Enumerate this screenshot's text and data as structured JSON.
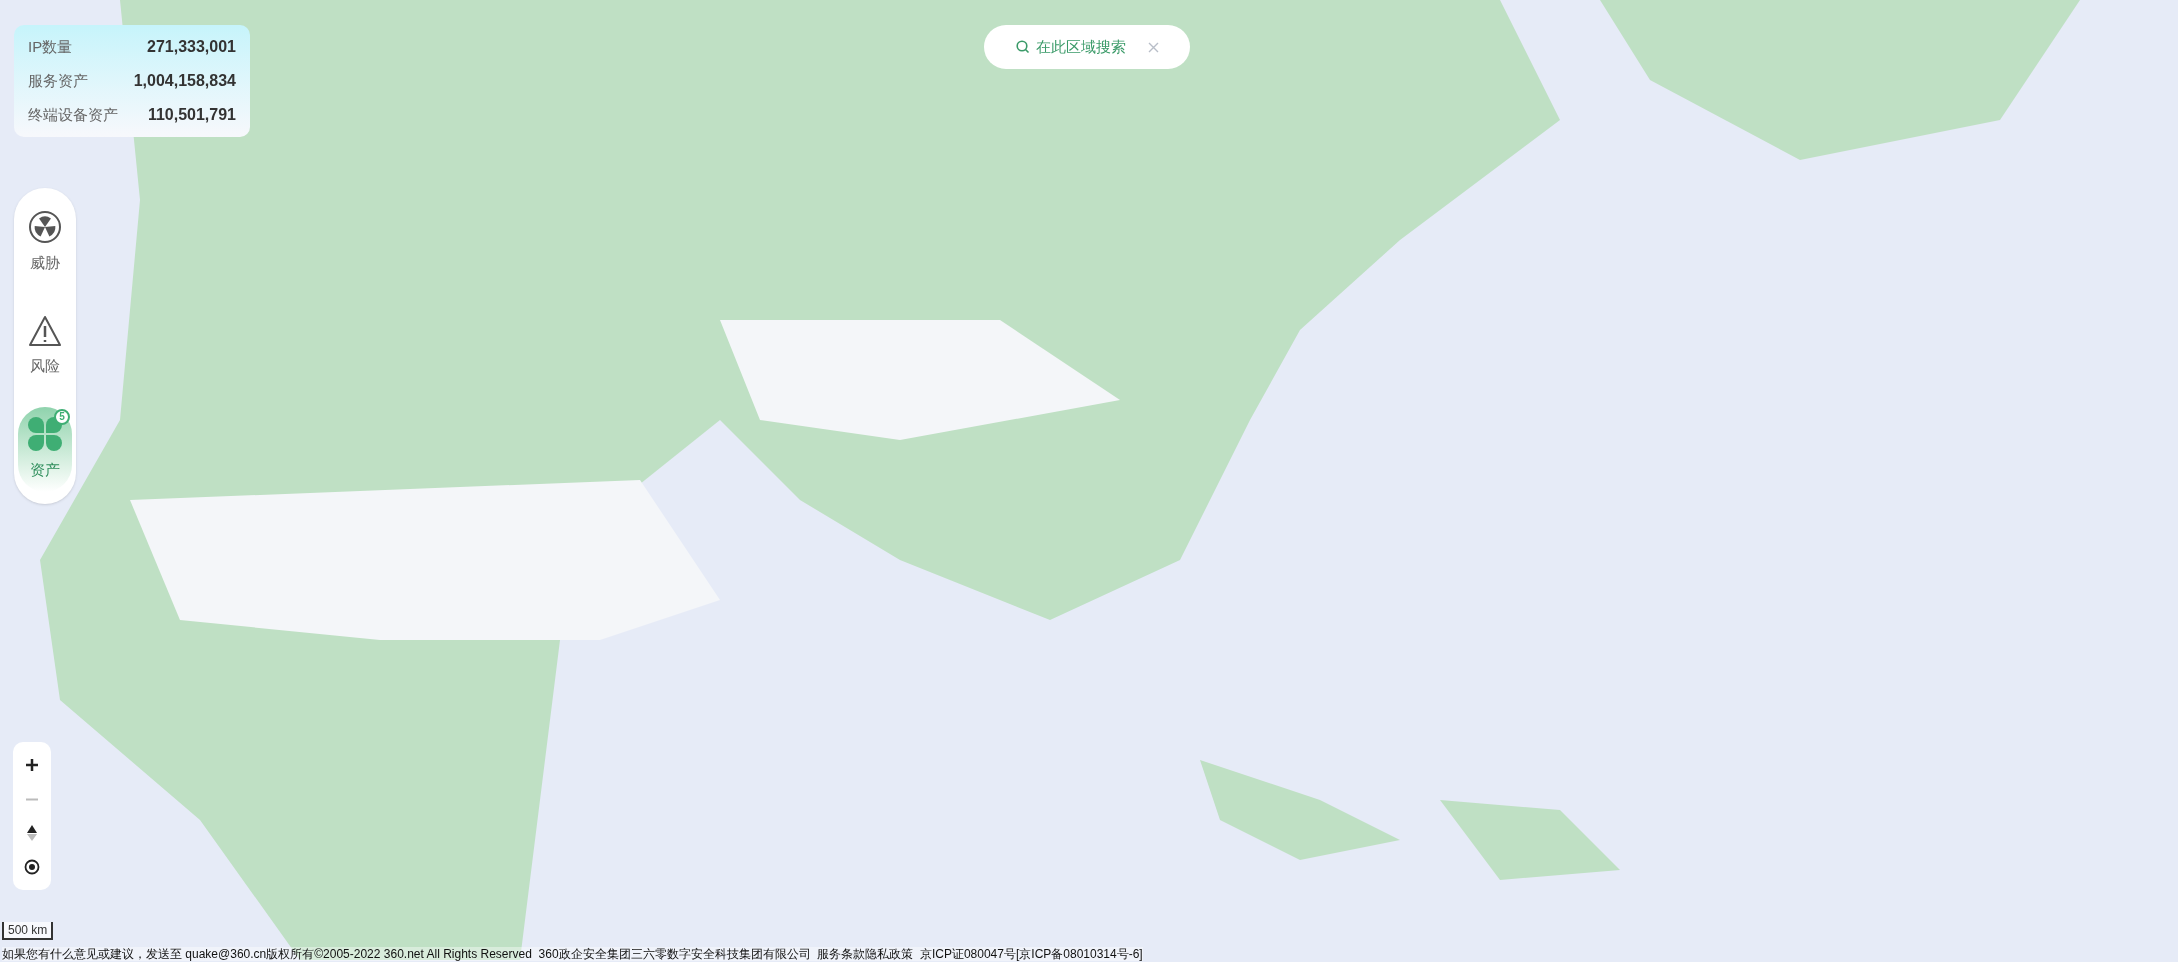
{
  "stats": [
    {
      "label": "IP数量",
      "value": "271,333,001"
    },
    {
      "label": "服务资产",
      "value": "1,004,158,834"
    },
    {
      "label": "终端设备资产",
      "value": "110,501,791"
    }
  ],
  "nav": [
    {
      "kind": "radiation",
      "label": "威胁",
      "selected": false
    },
    {
      "kind": "warning",
      "label": "风险",
      "selected": false
    },
    {
      "kind": "clover",
      "label": "资产",
      "selected": true,
      "badge": "5"
    }
  ],
  "search_button": {
    "label": "在此区域搜索"
  },
  "map_controls": [
    {
      "kind": "zoom_in",
      "disabled": false
    },
    {
      "kind": "zoom_out",
      "disabled": true
    },
    {
      "kind": "compass",
      "disabled": false
    },
    {
      "kind": "locate",
      "disabled": false
    }
  ],
  "scale": "500 km",
  "footer": "如果您有什么意见或建议，发送至 quake@360.cn版权所有©2005-2022 360.net All Rights Reserved  360政企安全集团三六零数字安全科技集团有限公司  服务条款隐私政策  京ICP证080047号[京ICP备08010314号-6]"
}
